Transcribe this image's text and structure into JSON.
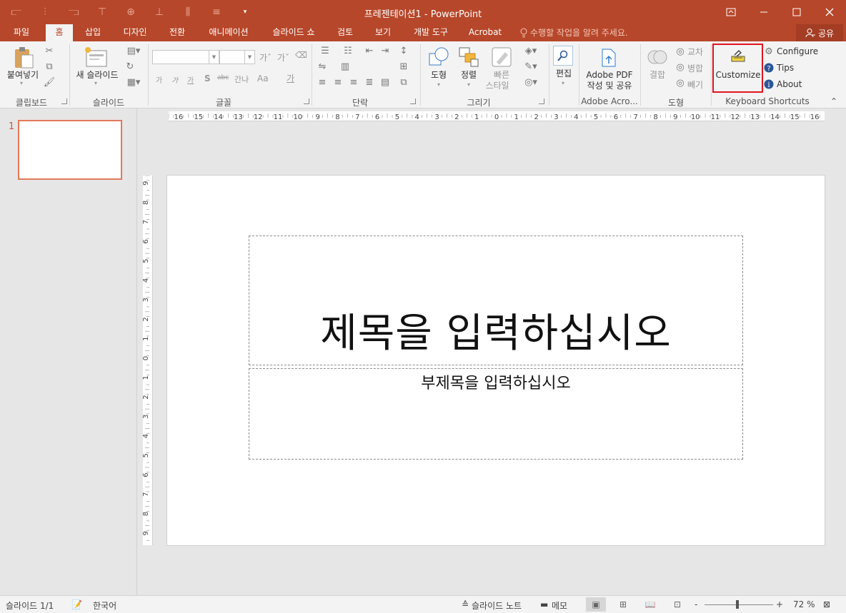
{
  "window": {
    "title": "프레젠테이션1 - PowerPoint",
    "controls": [
      "ribbon-display-icon",
      "minimize-icon",
      "maximize-icon",
      "close-icon"
    ]
  },
  "tabs": [
    {
      "label": "파일"
    },
    {
      "label": "홈"
    },
    {
      "label": "삽입"
    },
    {
      "label": "디자인"
    },
    {
      "label": "전환"
    },
    {
      "label": "애니메이션"
    },
    {
      "label": "슬라이드 쇼"
    },
    {
      "label": "검토"
    },
    {
      "label": "보기"
    },
    {
      "label": "개발 도구"
    },
    {
      "label": "Acrobat"
    }
  ],
  "active_tab": "홈",
  "tellme": {
    "text": "수행할 작업을 알려 주세요."
  },
  "share": {
    "label": "공유"
  },
  "ribbon": {
    "clipboard": {
      "paste_label": "붙여넣기",
      "group": "클립보드"
    },
    "slides": {
      "new_slide_label": "새 슬라이드",
      "group": "슬라이드"
    },
    "font": {
      "group": "글꼴",
      "font_name": "",
      "font_size": "",
      "buttons": [
        "가",
        "가",
        "가",
        "S",
        "abc",
        "간나",
        "Aa",
        "가"
      ]
    },
    "paragraph": {
      "group": "단락"
    },
    "drawing": {
      "shape_label": "도형",
      "arrange_label": "정렬",
      "quickstyle_label_1": "빠른",
      "quickstyle_label_2": "스타일",
      "group": "그리기"
    },
    "editing": {
      "label": "편집"
    },
    "adobe": {
      "label_1": "Adobe PDF",
      "label_2": "작성 및 공유",
      "group": "Adobe Acro..."
    },
    "shapes": {
      "merge_label": "결합",
      "intersect_label": "교차",
      "combine_label": "병합",
      "subtract_label": "빼기",
      "group": "도형"
    },
    "keyboard": {
      "customize_label": "Customize",
      "configure_label": "Configure",
      "tips_label": "Tips",
      "about_label": "About",
      "group": "Keyboard Shortcuts"
    }
  },
  "rulers": {
    "horizontal": [
      "16",
      "15",
      "14",
      "13",
      "12",
      "11",
      "10",
      "9",
      "8",
      "7",
      "6",
      "5",
      "4",
      "3",
      "2",
      "1",
      "0",
      "1",
      "2",
      "3",
      "4",
      "5",
      "6",
      "7",
      "8",
      "9",
      "10",
      "11",
      "12",
      "13",
      "14",
      "15",
      "16"
    ],
    "vertical": [
      "9",
      "8",
      "7",
      "6",
      "5",
      "4",
      "3",
      "2",
      "1",
      "0",
      "1",
      "2",
      "3",
      "4",
      "5",
      "6",
      "7",
      "8",
      "9"
    ]
  },
  "thumbnails": [
    {
      "number": "1"
    }
  ],
  "slide": {
    "title_placeholder": "제목을 입력하십시오",
    "subtitle_placeholder": "부제목을 입력하십시오"
  },
  "statusbar": {
    "slide_count": "슬라이드 1/1",
    "language": "한국어",
    "notes_label": "슬라이드 노트",
    "comments_label": "메모",
    "zoom_minus": "-",
    "zoom_plus": "+",
    "zoom_level": "72 %"
  }
}
